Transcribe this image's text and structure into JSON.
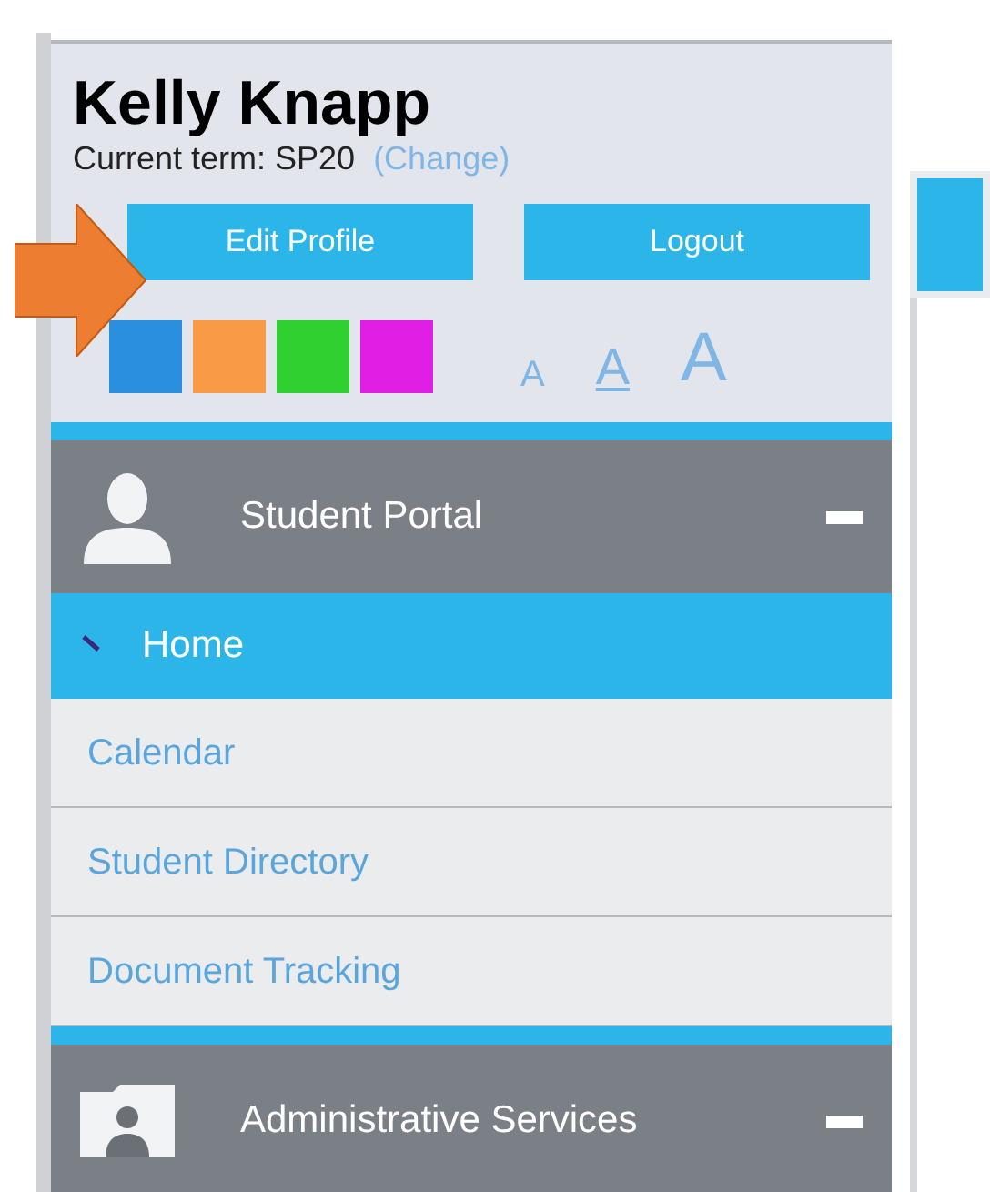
{
  "profile": {
    "name": "Kelly Knapp",
    "term_label": "Current term: SP20",
    "change_link": "(Change)"
  },
  "buttons": [
    {
      "label": "Edit Profile"
    },
    {
      "label": "Logout"
    }
  ],
  "color_swatches": [
    {
      "color": "#2b8fe0"
    },
    {
      "color": "#f99a45"
    },
    {
      "color": "#2fd030"
    },
    {
      "color": "#e11ee3"
    }
  ],
  "font_sizes": [
    {
      "label": "A",
      "selected": false
    },
    {
      "label": "A",
      "selected": true
    },
    {
      "label": "A",
      "selected": false
    }
  ],
  "sections": [
    {
      "title": "Student Portal",
      "expanded": true,
      "items": [
        {
          "label": "Home",
          "selected": true
        },
        {
          "label": "Calendar",
          "selected": false
        },
        {
          "label": "Student Directory",
          "selected": false
        },
        {
          "label": "Document Tracking",
          "selected": false
        }
      ]
    },
    {
      "title": "Administrative Services",
      "expanded": true
    }
  ]
}
